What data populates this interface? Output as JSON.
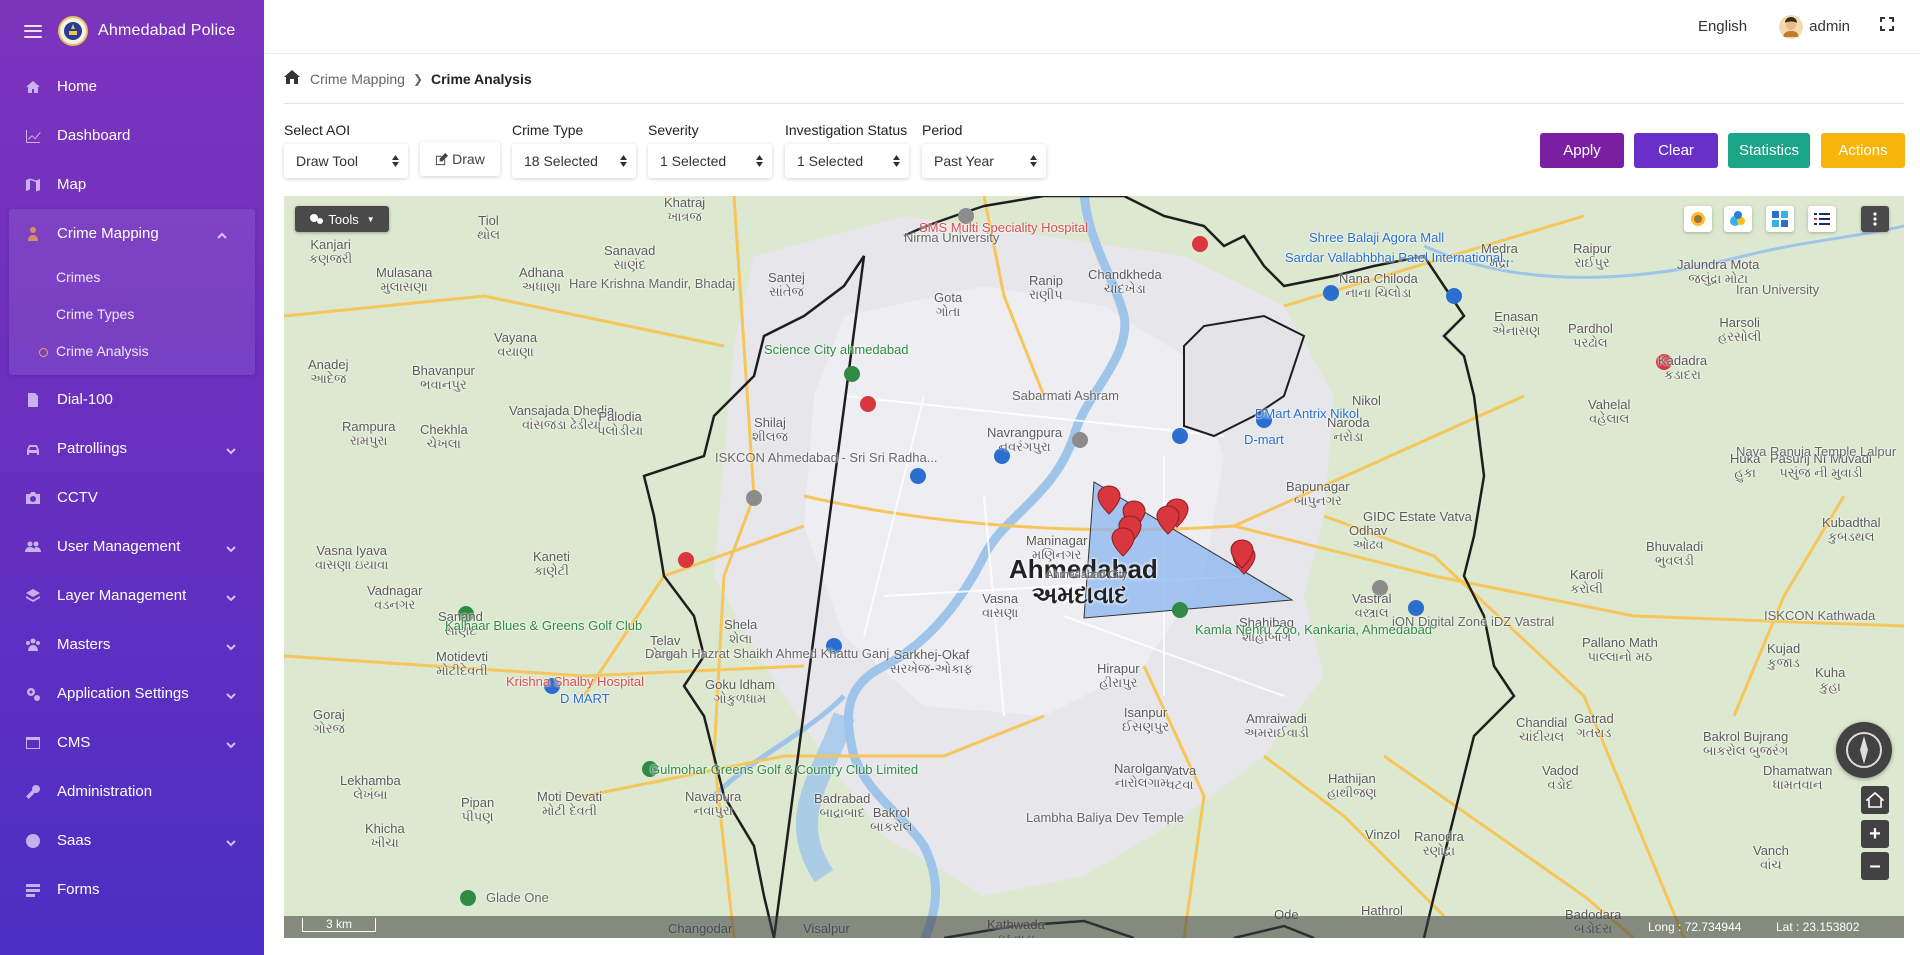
{
  "app": {
    "title": "Ahmedabad Police"
  },
  "topbar": {
    "language": "English",
    "username": "admin"
  },
  "sidebar": {
    "items": [
      {
        "label": "Home",
        "icon": "home-icon"
      },
      {
        "label": "Dashboard",
        "icon": "chart-line-icon"
      },
      {
        "label": "Map",
        "icon": "map-icon"
      },
      {
        "label": "Crime Mapping",
        "icon": "person-icon",
        "expanded": true,
        "children": [
          {
            "label": "Crimes"
          },
          {
            "label": "Crime Types"
          },
          {
            "label": "Crime Analysis",
            "active": true
          }
        ]
      },
      {
        "label": "Dial-100",
        "icon": "file-icon"
      },
      {
        "label": "Patrollings",
        "icon": "car-icon",
        "has_children": true
      },
      {
        "label": "CCTV",
        "icon": "camera-icon"
      },
      {
        "label": "User Management",
        "icon": "users-icon",
        "has_children": true
      },
      {
        "label": "Layer Management",
        "icon": "layers-icon",
        "has_children": true
      },
      {
        "label": "Masters",
        "icon": "group-icon",
        "has_children": true
      },
      {
        "label": "Application Settings",
        "icon": "gears-icon",
        "has_children": true
      },
      {
        "label": "CMS",
        "icon": "window-icon",
        "has_children": true
      },
      {
        "label": "Administration",
        "icon": "wrench-icon"
      },
      {
        "label": "Saas",
        "icon": "globe-icon",
        "has_children": true
      },
      {
        "label": "Forms",
        "icon": "forms-icon"
      }
    ]
  },
  "breadcrumb": {
    "parent": "Crime Mapping",
    "current": "Crime Analysis"
  },
  "filters": {
    "aoi": {
      "label": "Select AOI",
      "value": "Draw Tool"
    },
    "draw_button": "Draw",
    "crime_type": {
      "label": "Crime Type",
      "value": "18 Selected"
    },
    "severity": {
      "label": "Severity",
      "value": "1 Selected"
    },
    "investigation_status": {
      "label": "Investigation Status",
      "value": "1 Selected"
    },
    "period": {
      "label": "Period",
      "value": "Past Year"
    }
  },
  "actions": {
    "apply": {
      "label": "Apply",
      "color": "#7b1fa2"
    },
    "clear": {
      "label": "Clear",
      "color": "#6a2fc8"
    },
    "statistics": {
      "label": "Statistics",
      "color": "#1aa589"
    },
    "actions": {
      "label": "Actions",
      "color": "#f7b50c"
    }
  },
  "map": {
    "tools_label": "Tools",
    "scale": "3 km",
    "longitude": "Long : 72.734944",
    "latitude": "Lat : 23.153802",
    "city": {
      "en": "Ahmedabad",
      "gu": "અમદાવાદ",
      "sub": "Ahmedabad City"
    },
    "places": [
      "Khatraj\nખાત્રજ",
      "Kanjari\nકણજરી",
      "Mulasana\nમુલાસણા",
      "Sanavad\nસાણંદ",
      "Adhana\nઅધાણા",
      "Santej\nસાંતેજ",
      "Tiol\nથોલ",
      "Vayana\nવયાણા",
      "Anadej\nઆદેજ",
      "Bhavanpur\nભવાનપુર",
      "Rampura\nરામપુરા",
      "Chekhla\nચેખલા",
      "Vansajada Dhedia\nવાંસજડા ઢેડીયા",
      "Palodia\nપલોડીયા",
      "Shilaj\nશીલજ",
      "Vasna Iyava\nવાસણા ઇયાવા",
      "Vadnagar\nવડનગર",
      "Kaneti\nકાણેટી",
      "Sanand\nસાણંદ",
      "Shela\nશેલા",
      "Telav\nતેલાવ",
      "Goraj\nગોરજ",
      "Motidevti\nમોટીદેવતી",
      "Lekhamba\nલેખંબા",
      "Khicha\nખીચા",
      "Pipan\nપીપણ",
      "Moti Devati\nમોટી દેવતી",
      "Navapura\nનવાપુરા",
      "Bakrol\nબાકરોલ",
      "Badrabad\nબાદ્રાબાદ",
      "Changodar",
      "Visalpur",
      "Vasna\nવાસણા",
      "Sarkhej-Okaf\nસરખેજ-ઓકાફ",
      "Goku ldham\nગોકુળધામ",
      "Ranip\nરાણીપ",
      "Gota\nગોતા",
      "Chandkheda\nચાંદખેડા",
      "Naroda\nનરોડા",
      "Nana Chiloda\nનાના ચિલોડા",
      "Bapunagar\nબાપુનગર",
      "Odhav\nઓઢવ",
      "Nikol",
      "Vastral\nવસ્ત્રાલ",
      "Isanpur\nઈસણપુર",
      "Narolgam\nનારોલગામ",
      "Vatva\nવટવા",
      "Hathijan\nહાથીજણ",
      "Vinzol",
      "Medra\nમેદ્રા",
      "Raipur\nરાઈપુર",
      "Jalundra Mota\nજલુંદ્રા મોટા",
      "Enasan\nએનાસણ",
      "Pardhol\nપરઢોલ",
      "Harsoli\nહરસોલી",
      "Kadadra\nકડાદરા",
      "Vahelal\nવહેલાલ",
      "Huka\nહુકા",
      "Pasunj NI Muvadi\nપસુંજ ની મુવાડી",
      "Karoli\nકરોલી",
      "Bhuvaladi\nભુવલડી",
      "Kubadthal\nકુબડથલ",
      "Pallano Math\nપાલ્લાનો મઠ",
      "Kujad\nકુજાડ",
      "Kuha\nકુહા",
      "Chandial\nચાંદીયલ",
      "Gatrad\nગતરાડ",
      "Bakrol Bujrang\nબાકરોલ બુજરંગ",
      "Vadod\nવડોદ",
      "Dhamatwan\nધામતવાન",
      "Ranodra\nરણોદ્રા",
      "Vanch\nવાંચ",
      "Hathrol",
      "Badodara\nબડોદરા",
      "Hirapur\nહીરાપુર",
      "Maninagar\nમણિનગર",
      "Navrangpura\nનવરંગપુરા",
      "Shahibag\nશાહીબાગ",
      "Amraiwadi\nઅમરાઈવાડી",
      "GIDC Estate Vatva",
      "Kathwada\nકઠવાડા",
      "Ode",
      "Gamdi\nગામડી"
    ],
    "pois": [
      "SMS Multi Speciality Hospital",
      "Shree Balaji Agora Mall",
      "Nirma University",
      "Sardar Vallabhbhai Patel International...",
      "Science City ahmedabad",
      "Hare Krishna Mandir, Bhadaj",
      "Sabarmati Ashram",
      "ISKCON Ahmedabad - Sri Sri Radha...",
      "DMart Antrix Nikol",
      "D-mart",
      "Kalhaar Blues & Greens Golf Club",
      "Krishna Shalby Hospital",
      "Kamla Nehru Zoo, Kankaria, Ahmedabad",
      "iON Digital Zone iDZ Vastral",
      "Dargah Hazrat Shaikh Ahmed Khattu Ganj",
      "D MART",
      "Gulmohar Greens Golf & Country Club Limited",
      "Lambha Baliya Dev Temple",
      "Glade One",
      "ISKCON Kathwada",
      "Nava Ranuja Temple Lalpur",
      "Iran University"
    ],
    "markers_count": 8
  }
}
